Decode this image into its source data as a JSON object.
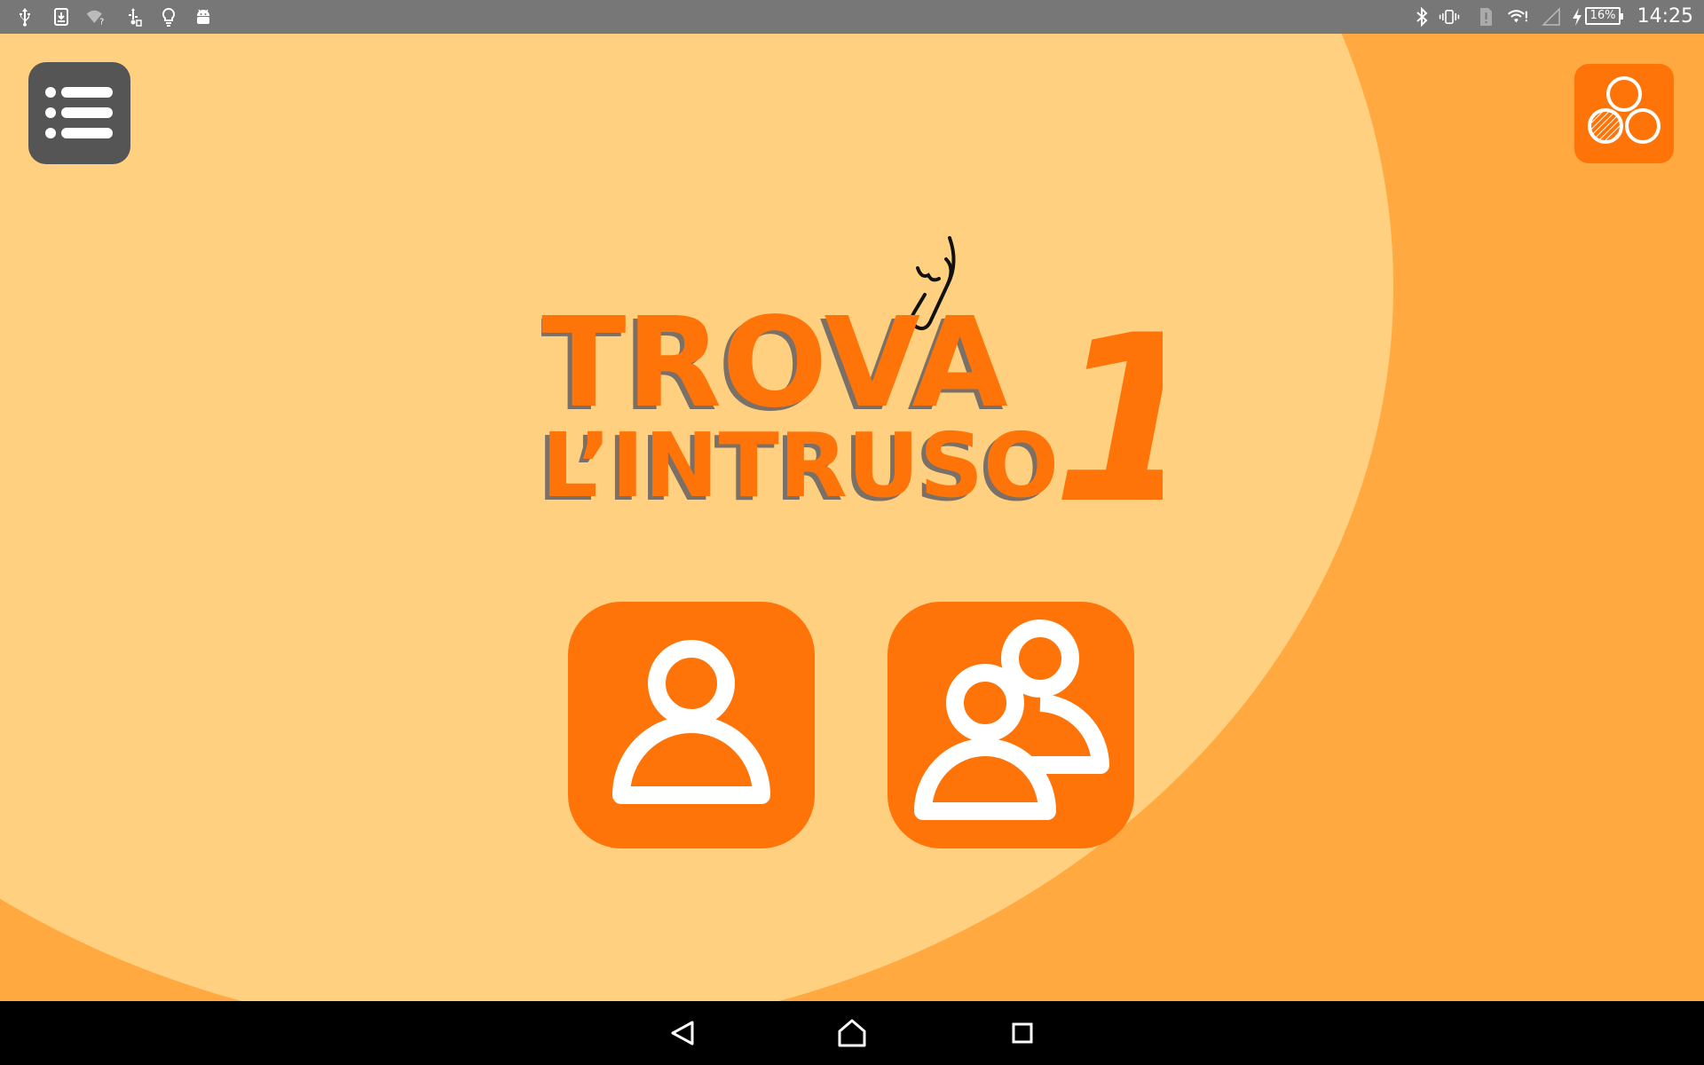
{
  "status_bar": {
    "clock": "14:25",
    "battery_level": "16%",
    "left_icons": [
      "usb-icon",
      "download-icon",
      "wifi-unknown-icon",
      "usb-debug-icon",
      "lightbulb-icon",
      "android-icon"
    ],
    "right_icons": [
      "bluetooth-icon",
      "vibrate-icon",
      "sim-alert-icon",
      "wifi-alert-icon",
      "signal-empty-icon",
      "charging-bolt-icon",
      "battery-icon"
    ]
  },
  "app": {
    "logo": {
      "line1": "TROVA",
      "line2": "L’INTRUSO",
      "number": "1"
    },
    "menu_button_icon": "list-menu-icon",
    "circles_button_icon": "three-circles-icon",
    "single_player_icon": "single-user-icon",
    "multi_player_icon": "multi-user-icon"
  },
  "colors": {
    "accent": "#FF7409",
    "background_light": "#FFD080",
    "background_dark": "#FFA940",
    "menu_button": "#555555",
    "logo_shadow": "#7A7067"
  },
  "nav_bar": {
    "icons": [
      "back-icon",
      "home-icon",
      "recents-icon"
    ]
  }
}
